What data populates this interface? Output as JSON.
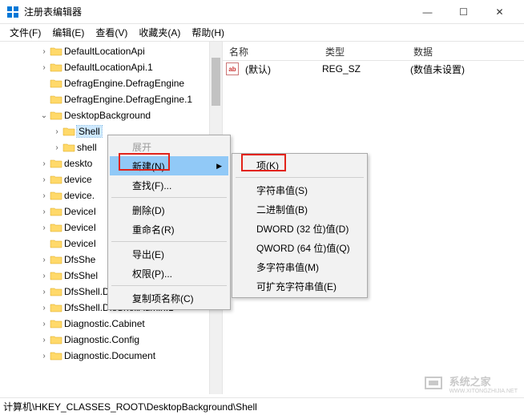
{
  "window": {
    "title": "注册表编辑器"
  },
  "menubar": {
    "file": "文件(F)",
    "edit": "编辑(E)",
    "view": "查看(V)",
    "favorites": "收藏夹(A)",
    "help": "帮助(H)"
  },
  "tree": {
    "items": [
      {
        "indent": 3,
        "expander": "›",
        "label": "DefaultLocationApi"
      },
      {
        "indent": 3,
        "expander": "›",
        "label": "DefaultLocationApi.1"
      },
      {
        "indent": 3,
        "expander": "",
        "label": "DefragEngine.DefragEngine"
      },
      {
        "indent": 3,
        "expander": "",
        "label": "DefragEngine.DefragEngine.1"
      },
      {
        "indent": 3,
        "expander": "⌄",
        "label": "DesktopBackground"
      },
      {
        "indent": 4,
        "expander": "›",
        "label": "Shell",
        "selected": true
      },
      {
        "indent": 4,
        "expander": "›",
        "label": "shell"
      },
      {
        "indent": 3,
        "expander": "›",
        "label": "deskto"
      },
      {
        "indent": 3,
        "expander": "›",
        "label": "device"
      },
      {
        "indent": 3,
        "expander": "›",
        "label": "device."
      },
      {
        "indent": 3,
        "expander": "›",
        "label": "DeviceI"
      },
      {
        "indent": 3,
        "expander": "›",
        "label": "DeviceI"
      },
      {
        "indent": 3,
        "expander": "",
        "label": "DeviceI"
      },
      {
        "indent": 3,
        "expander": "›",
        "label": "DfsShe"
      },
      {
        "indent": 3,
        "expander": "›",
        "label": "DfsShel"
      },
      {
        "indent": 3,
        "expander": "›",
        "label": "DfsShell.DfsShellAdmin"
      },
      {
        "indent": 3,
        "expander": "›",
        "label": "DfsShell.DfsShellAdmin.1"
      },
      {
        "indent": 3,
        "expander": "›",
        "label": "Diagnostic.Cabinet"
      },
      {
        "indent": 3,
        "expander": "›",
        "label": "Diagnostic.Config"
      },
      {
        "indent": 3,
        "expander": "›",
        "label": "Diagnostic.Document"
      }
    ]
  },
  "list": {
    "columns": {
      "name": "名称",
      "type": "类型",
      "data": "数据"
    },
    "rows": [
      {
        "icon": "ab",
        "name": "(默认)",
        "type": "REG_SZ",
        "data": "(数值未设置)"
      }
    ]
  },
  "context_menu_1": {
    "expand": "展开",
    "new": "新建(N)",
    "find": "查找(F)...",
    "delete": "删除(D)",
    "rename": "重命名(R)",
    "export": "导出(E)",
    "permissions": "权限(P)...",
    "copy_key_name": "复制项名称(C)"
  },
  "context_menu_2": {
    "key": "项(K)",
    "string": "字符串值(S)",
    "binary": "二进制值(B)",
    "dword": "DWORD (32 位)值(D)",
    "qword": "QWORD (64 位)值(Q)",
    "multi_string": "多字符串值(M)",
    "expandable_string": "可扩充字符串值(E)"
  },
  "statusbar": {
    "path": "计算机\\HKEY_CLASSES_ROOT\\DesktopBackground\\Shell"
  },
  "watermark": {
    "line1": "系统之家",
    "line2": "WWW.XITONGZHIJIA.NET"
  }
}
